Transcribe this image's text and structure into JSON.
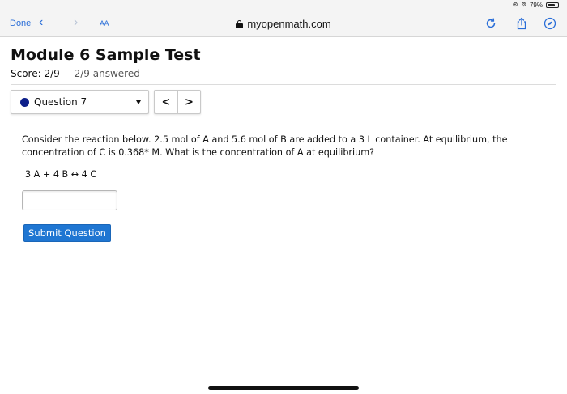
{
  "status_bar": {
    "battery_text": "79%",
    "battery_level": 0.79
  },
  "browser": {
    "done_label": "Done",
    "back_glyph": "‹",
    "forward_glyph": "›",
    "reader_label": "AA",
    "url": "myopenmath.com",
    "icons": [
      "lock-icon",
      "reload-icon",
      "share-icon",
      "compass-icon"
    ]
  },
  "page": {
    "title": "Module 6 Sample Test",
    "score_label": "Score: 2/9",
    "answered_label": "2/9 answered"
  },
  "question_nav": {
    "selected": "Question 7",
    "status_color": "#0d1f8a",
    "prev_glyph": "<",
    "next_glyph": ">"
  },
  "question": {
    "text": "Consider the reaction below.  2.5 mol of A and 5.6 mol of B are added to a 3 L container.  At equilibrium, the concentration of C is 0.368* M.  What is the concentration of A at equilibrium?",
    "reaction": "3 A + 4 B  ↔  4 C",
    "answer_value": "",
    "submit_label": "Submit Question"
  },
  "colors": {
    "accent": "#1f76d2",
    "link": "#2a6ed8"
  }
}
